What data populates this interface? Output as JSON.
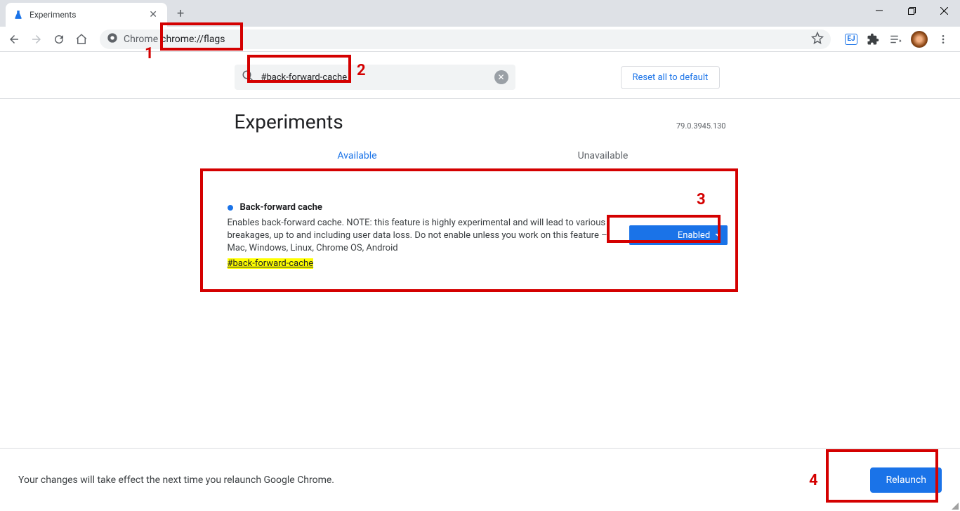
{
  "browser": {
    "tab_title": "Experiments",
    "url_prefix": "Chrome",
    "url": "chrome://flags"
  },
  "search": {
    "query": "#back-forward-cache",
    "reset_label": "Reset all to default"
  },
  "header": {
    "title": "Experiments",
    "version": "79.0.3945.130"
  },
  "tabs": {
    "available": "Available",
    "unavailable": "Unavailable"
  },
  "flag": {
    "title": "Back-forward cache",
    "description": "Enables back-forward cache. NOTE: this feature is highly experimental and will lead to various breakages, up to and including user data loss. Do not enable unless you work on this feature – Mac, Windows, Linux, Chrome OS, Android",
    "link": "#back-forward-cache",
    "select_value": "Enabled"
  },
  "relaunch": {
    "message": "Your changes will take effect the next time you relaunch Google Chrome.",
    "button": "Relaunch"
  },
  "annotations": {
    "n1": "1",
    "n2": "2",
    "n3": "3",
    "n4": "4"
  }
}
